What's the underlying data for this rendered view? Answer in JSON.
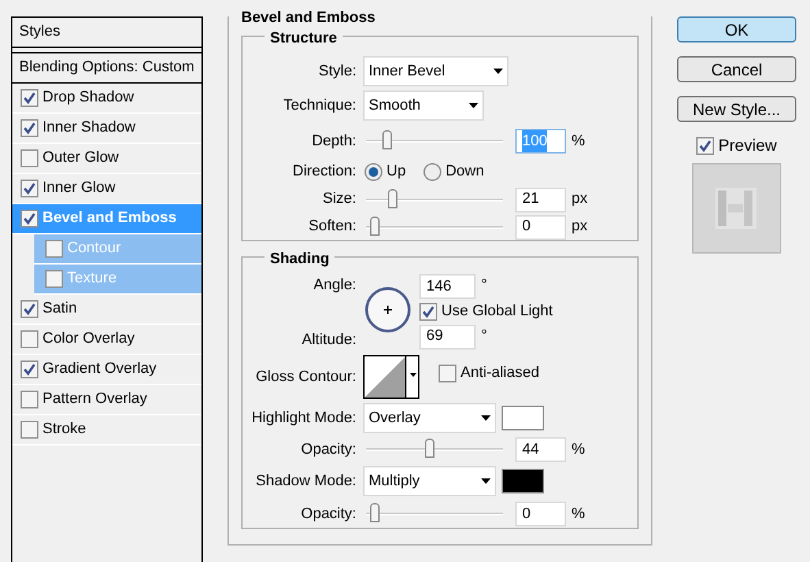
{
  "styles_panel": {
    "title": "Styles",
    "header": "Blending Options: Custom",
    "items": [
      {
        "label": "Drop Shadow",
        "checked": true,
        "selected": false
      },
      {
        "label": "Inner Shadow",
        "checked": true,
        "selected": false
      },
      {
        "label": "Outer Glow",
        "checked": false,
        "selected": false
      },
      {
        "label": "Inner Glow",
        "checked": true,
        "selected": false
      },
      {
        "label": "Bevel and Emboss",
        "checked": true,
        "selected": true,
        "children": [
          {
            "label": "Contour",
            "checked": false,
            "selected": false
          },
          {
            "label": "Texture",
            "checked": false,
            "selected": false
          }
        ]
      },
      {
        "label": "Satin",
        "checked": true,
        "selected": false
      },
      {
        "label": "Color Overlay",
        "checked": false,
        "selected": false
      },
      {
        "label": "Gradient Overlay",
        "checked": true,
        "selected": false
      },
      {
        "label": "Pattern Overlay",
        "checked": false,
        "selected": false
      },
      {
        "label": "Stroke",
        "checked": false,
        "selected": false
      }
    ]
  },
  "bevel_and_emboss": {
    "title": "Bevel and Emboss",
    "structure": {
      "title": "Structure",
      "style": {
        "label": "Style:",
        "value": "Inner Bevel"
      },
      "technique": {
        "label": "Technique:",
        "value": "Smooth"
      },
      "depth": {
        "label": "Depth:",
        "level": 0.1,
        "value": "100",
        "value_selected": true,
        "unit": "%"
      },
      "direction": {
        "label": "Direction:",
        "options": [
          {
            "label": "Up",
            "selected": true
          },
          {
            "label": "Down",
            "selected": false
          }
        ]
      },
      "size": {
        "label": "Size:",
        "level": 0.14,
        "value": "21",
        "value_selected": false,
        "unit": "px"
      },
      "soften": {
        "label": "Soften:",
        "level": 0,
        "value": "0",
        "value_selected": false,
        "unit": "px"
      }
    },
    "shading": {
      "title": "Shading",
      "angle": {
        "label": "Angle:",
        "value": "146",
        "unit": "°"
      },
      "use_global_light": {
        "label": "Use Global Light",
        "checked": true
      },
      "altitude": {
        "label": "Altitude:",
        "value": "69",
        "unit": "°"
      },
      "gloss_contour": {
        "label": "Gloss Contour:"
      },
      "anti_aliased": {
        "label": "Anti-aliased",
        "checked": false
      },
      "highlight_mode": {
        "label": "Highlight Mode:",
        "value": "Overlay",
        "color": "#ffffff"
      },
      "highlight_opacity": {
        "label": "Opacity:",
        "level": 0.44,
        "value": "44",
        "value_selected": false,
        "unit": "%"
      },
      "shadow_mode": {
        "label": "Shadow Mode:",
        "value": "Multiply",
        "color": "#000000"
      },
      "shadow_opacity": {
        "label": "Opacity:",
        "level": 0,
        "value": "0",
        "value_selected": false,
        "unit": "%"
      }
    }
  },
  "buttons": [
    {
      "label": "OK",
      "default": true
    },
    {
      "label": "Cancel",
      "default": false
    },
    {
      "label": "New Style...",
      "default": false
    }
  ],
  "preview": {
    "label": "Preview",
    "checked": true
  }
}
